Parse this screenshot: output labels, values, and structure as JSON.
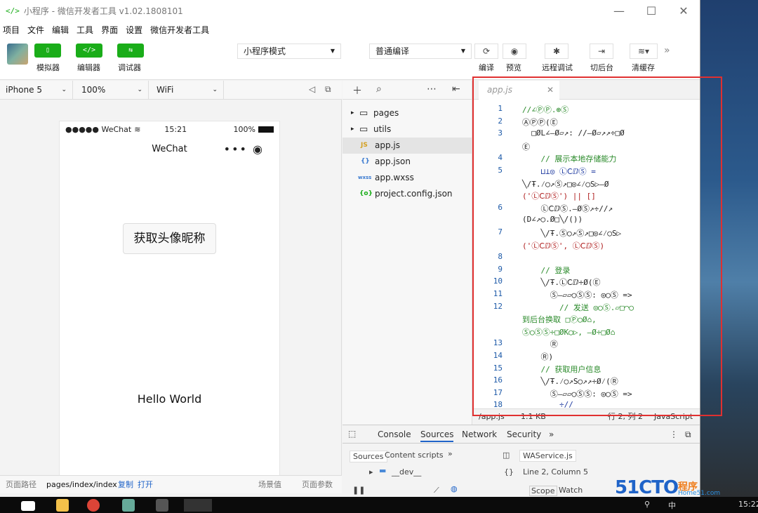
{
  "window": {
    "title": "小程序 - 微信开发者工具 v1.02.1808101",
    "logo": "</>",
    "min": "—",
    "max": "☐",
    "close": "✕"
  },
  "menu": [
    "项目",
    "文件",
    "编辑",
    "工具",
    "界面",
    "设置",
    "微信开发者工具"
  ],
  "toolbar": {
    "simulator": "模拟器",
    "editor": "编辑器",
    "debugger": "调试器",
    "mode": "小程序模式",
    "compile_mode": "普通编译",
    "compile": "编译",
    "preview": "预览",
    "remote_debug": "远程调试",
    "background": "切后台",
    "clear_cache": "清缓存"
  },
  "simbar": {
    "device": "iPhone 5",
    "zoom": "100%",
    "network": "WiFi"
  },
  "phone": {
    "carrier": "●●●●● WeChat",
    "time": "15:21",
    "battery": "100%",
    "nav_title": "WeChat",
    "button_text": "获取头像昵称",
    "hello": "Hello World"
  },
  "sim_footer": {
    "path_label": "页面路径",
    "path": "pages/index/index",
    "copy": "复制",
    "open": "打开",
    "scene": "场景值",
    "params": "页面参数"
  },
  "filetree": [
    {
      "name": "pages",
      "type": "folder"
    },
    {
      "name": "utils",
      "type": "folder"
    },
    {
      "name": "app.js",
      "type": "js"
    },
    {
      "name": "app.json",
      "type": "json"
    },
    {
      "name": "app.wxss",
      "type": "wxss"
    },
    {
      "name": "project.config.json",
      "type": "config"
    }
  ],
  "editor": {
    "tab": "app.js",
    "lines": [
      {
        "n": "1",
        "text": "//∠ⓅⓅ.⊕Ⓢ",
        "cls": "cmt"
      },
      {
        "n": "2",
        "text": "ⒶⓅⓅ(Ⓔ",
        "cls": ""
      },
      {
        "n": "3",
        "text": "  □ØL∠—Ø▱↗: //—Ø▱↗↗÷□Ø",
        "cls": ""
      },
      {
        "n": "",
        "text": "Ⓔ",
        "cls": ""
      },
      {
        "n": "4",
        "text": "    // 展示本地存储能力",
        "cls": "cmt"
      },
      {
        "n": "5",
        "text": "    ⊔⊥◎ ⓁⅭⅅⓈ =",
        "cls": "kw"
      },
      {
        "n": "",
        "text": "╲∕Ŧ.⁄◯↗Ⓢ↗□◎∠⁄◯S▷—Ø",
        "cls": ""
      },
      {
        "n": "",
        "text": "('ⓁⅭⅅⓈ') || []",
        "cls": "str"
      },
      {
        "n": "6",
        "text": "    ⓁⅭⅅⓈ.—ØⓈ↗÷//↗",
        "cls": ""
      },
      {
        "n": "",
        "text": "(D∠↗◯.Ø□╲∕())",
        "cls": ""
      },
      {
        "n": "7",
        "text": "    ╲∕Ŧ.Ⓢ◯↗Ⓢ↗□◎∠⁄◯S▷",
        "cls": ""
      },
      {
        "n": "",
        "text": "('ⓁⅭⅅⓈ', ⓁⅭⅅⓈ)",
        "cls": "str"
      },
      {
        "n": "8",
        "text": "",
        "cls": ""
      },
      {
        "n": "9",
        "text": "    // 登录",
        "cls": "cmt"
      },
      {
        "n": "10",
        "text": "    ╲∕Ŧ.ⓁⅭⅅ÷Ø(Ⓔ",
        "cls": ""
      },
      {
        "n": "11",
        "text": "      Ⓢ—▱▱◯ⓈⓈ: ◎◯Ⓢ =>",
        "cls": ""
      },
      {
        "n": "12",
        "text": "        // 发送 ◎◯Ⓢ.▱□◠◯",
        "cls": "cmt"
      },
      {
        "n": "",
        "text": "到后台换取 □Ⓟ◯Ø⌂,",
        "cls": "cmt"
      },
      {
        "n": "",
        "text": "Ⓢ◯ⓈⓈ÷□ØK◯▷, —Ø÷□Ø⌂",
        "cls": "cmt"
      },
      {
        "n": "13",
        "text": "      Ⓡ",
        "cls": ""
      },
      {
        "n": "14",
        "text": "    Ⓡ)",
        "cls": ""
      },
      {
        "n": "15",
        "text": "    // 获取用户信息",
        "cls": "cmt"
      },
      {
        "n": "16",
        "text": "    ╲∕Ŧ.⁄◯↗S◯↗↗÷Ø⁄(Ⓡ",
        "cls": ""
      },
      {
        "n": "17",
        "text": "      Ⓢ—▱▱◯ⓈⓈ: ◎◯Ⓢ =>",
        "cls": ""
      },
      {
        "n": "18",
        "text": "        ÷//",
        "cls": "kw"
      }
    ],
    "status": {
      "file": "/app.js",
      "size": "1.1 KB",
      "cursor": "行 2, 列 2",
      "lang": "JavaScript"
    }
  },
  "devtools": {
    "tabs": [
      "Console",
      "Sources",
      "Network",
      "Security"
    ],
    "sources_tab": "Sources",
    "content_scripts": "Content scripts",
    "folder": "__dev__",
    "file": "WAService.js",
    "position": "Line 2, Column 5",
    "scope": "Scope",
    "watch": "Watch"
  },
  "watermark": {
    "main": "51CTO",
    "cn": "程序",
    "sub": "Home51.com"
  },
  "taskbar": {
    "clock": "15:22",
    "ime": "中"
  },
  "colors": {
    "accent": "#1aad19",
    "highlight_box": "#e03030"
  }
}
